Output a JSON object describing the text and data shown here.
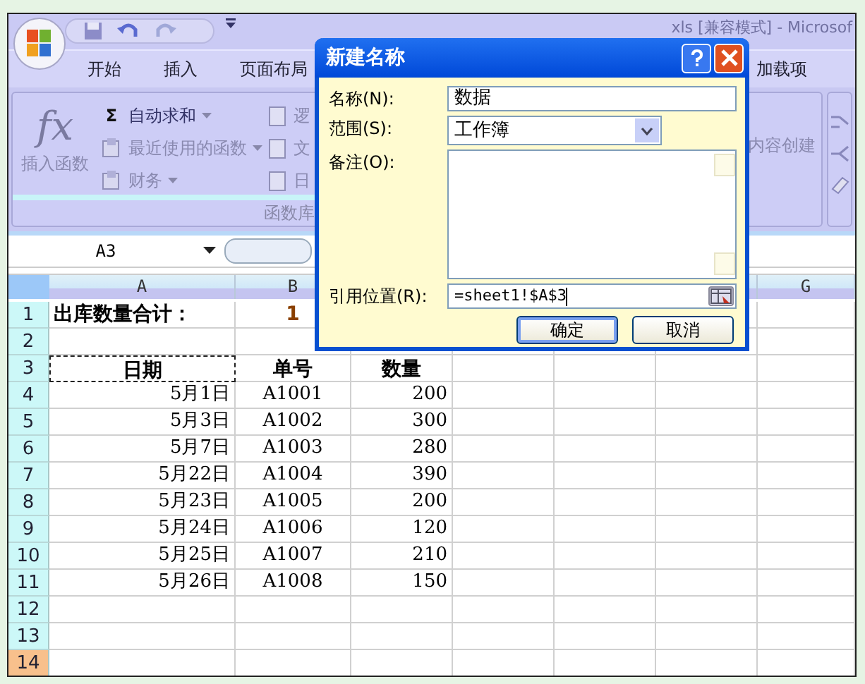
{
  "window": {
    "title": "xls [兼容模式] - Microsof"
  },
  "ribbon_tabs": [
    {
      "label": "开始"
    },
    {
      "label": "插入"
    },
    {
      "label": "页面布局"
    },
    {
      "label": "加载项"
    }
  ],
  "ribbon": {
    "insert_function": {
      "glyph": "fx",
      "label": "插入函数"
    },
    "commands": [
      {
        "glyph": "Σ",
        "label": "自动求和",
        "dropdown": true
      },
      {
        "label": "最近使用的函数",
        "dropdown": true
      },
      {
        "label": "财务",
        "dropdown": true
      }
    ],
    "partial_commands": [
      "逻",
      "文",
      "日"
    ],
    "group_label": "函数库",
    "right_command": "内容创建"
  },
  "formula_bar": {
    "name_box": "A3"
  },
  "sheet": {
    "columns": [
      {
        "label": "A"
      },
      {
        "label": "B"
      },
      {},
      {},
      {},
      {},
      {
        "label": "G"
      }
    ],
    "rows": [
      {
        "number": "1",
        "kind": "title",
        "highlighted": false,
        "cells": [
          {
            "text": "出库数量合计："
          },
          {
            "text": "1"
          }
        ]
      },
      {
        "number": "2",
        "kind": "data",
        "highlighted": false,
        "cells": []
      },
      {
        "number": "3",
        "kind": "header",
        "highlighted": false,
        "cells": [
          {
            "text": "日期",
            "selected": true
          },
          {
            "text": "单号"
          },
          {
            "text": "数量"
          }
        ]
      },
      {
        "number": "4",
        "kind": "data",
        "highlighted": false,
        "cells": [
          {
            "text": "5月1日"
          },
          {
            "text": "A1001"
          },
          {
            "text": "200"
          }
        ]
      },
      {
        "number": "5",
        "kind": "data",
        "highlighted": false,
        "cells": [
          {
            "text": "5月3日"
          },
          {
            "text": "A1002"
          },
          {
            "text": "300"
          }
        ]
      },
      {
        "number": "6",
        "kind": "data",
        "highlighted": false,
        "cells": [
          {
            "text": "5月7日"
          },
          {
            "text": "A1003"
          },
          {
            "text": "280"
          }
        ]
      },
      {
        "number": "7",
        "kind": "data",
        "highlighted": false,
        "cells": [
          {
            "text": "5月22日"
          },
          {
            "text": "A1004"
          },
          {
            "text": "390"
          }
        ]
      },
      {
        "number": "8",
        "kind": "data",
        "highlighted": false,
        "cells": [
          {
            "text": "5月23日"
          },
          {
            "text": "A1005"
          },
          {
            "text": "200"
          }
        ]
      },
      {
        "number": "9",
        "kind": "data",
        "highlighted": false,
        "cells": [
          {
            "text": "5月24日"
          },
          {
            "text": "A1006"
          },
          {
            "text": "120"
          }
        ]
      },
      {
        "number": "10",
        "kind": "data",
        "highlighted": false,
        "cells": [
          {
            "text": "5月25日"
          },
          {
            "text": "A1007"
          },
          {
            "text": "210"
          }
        ]
      },
      {
        "number": "11",
        "kind": "data",
        "highlighted": false,
        "cells": [
          {
            "text": "5月26日"
          },
          {
            "text": "A1008"
          },
          {
            "text": "150"
          }
        ]
      },
      {
        "number": "12",
        "kind": "data",
        "highlighted": false,
        "cells": []
      },
      {
        "number": "13",
        "kind": "data",
        "highlighted": false,
        "cells": []
      },
      {
        "number": "14",
        "kind": "data",
        "highlighted": true,
        "cells": []
      }
    ]
  },
  "dialog": {
    "title": "新建名称",
    "fields": [
      {
        "label": "名称(N):",
        "kind": "text",
        "value": "数据"
      },
      {
        "label": "范围(S):",
        "kind": "select",
        "value": "工作簿"
      },
      {
        "label": "备注(O):",
        "kind": "textarea"
      },
      {
        "label": "引用位置(R):",
        "kind": "reference",
        "value": "=sheet1!$A$3"
      }
    ],
    "buttons": [
      {
        "label": "确定",
        "default": true
      },
      {
        "label": "取消",
        "default": false
      }
    ]
  }
}
